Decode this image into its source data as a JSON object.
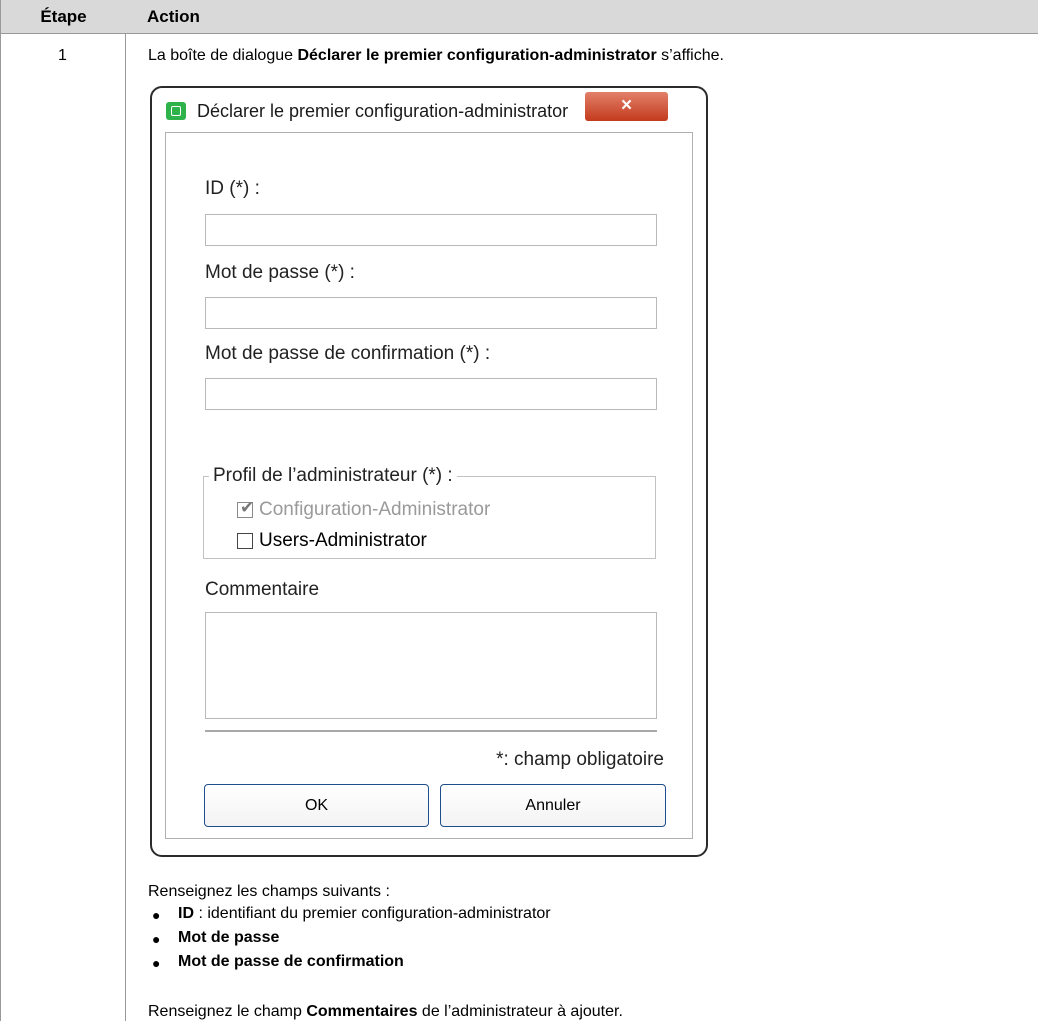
{
  "table": {
    "header_step": "Étape",
    "header_action": "Action",
    "step_number": "1",
    "intro_prefix": "La boîte de dialogue ",
    "intro_bold": "Déclarer le premier configuration-administrator",
    "intro_suffix": " s’affiche."
  },
  "dialog": {
    "title": "Déclarer le premier configuration-administrator",
    "close_symbol": "×",
    "id_label": "ID (*) :",
    "id_value": "",
    "password_label": "Mot de passe (*) :",
    "password_value": "",
    "confirm_label": "Mot de passe de confirmation (*) :",
    "confirm_value": "",
    "profile_group_label": "Profil de l’administrateur (*) :",
    "profiles": [
      {
        "label": "Configuration-Administrator",
        "checked": true,
        "enabled": false
      },
      {
        "label": "Users-Administrator",
        "checked": false,
        "enabled": true
      }
    ],
    "comment_label": "Commentaire",
    "comment_value": "",
    "required_note": "*: champ obligatoire",
    "ok_label": "OK",
    "cancel_label": "Annuler"
  },
  "instructions": {
    "fill_intro": "Renseignez les champs suivants :",
    "bullets": [
      {
        "bold": "ID",
        "text": " : identifiant du premier configuration-administrator"
      },
      {
        "bold": "Mot de passe",
        "text": ""
      },
      {
        "bold": "Mot de passe de confirmation",
        "text": ""
      }
    ],
    "comment_prefix": "Renseignez le champ ",
    "comment_bold": "Commentaires",
    "comment_suffix": " de l’administrateur à ajouter."
  },
  "colors": {
    "header_bg": "#d9d9d9",
    "close_button": "#c33a1c",
    "app_icon": "#2db34a",
    "button_border": "#1f4e8c"
  }
}
